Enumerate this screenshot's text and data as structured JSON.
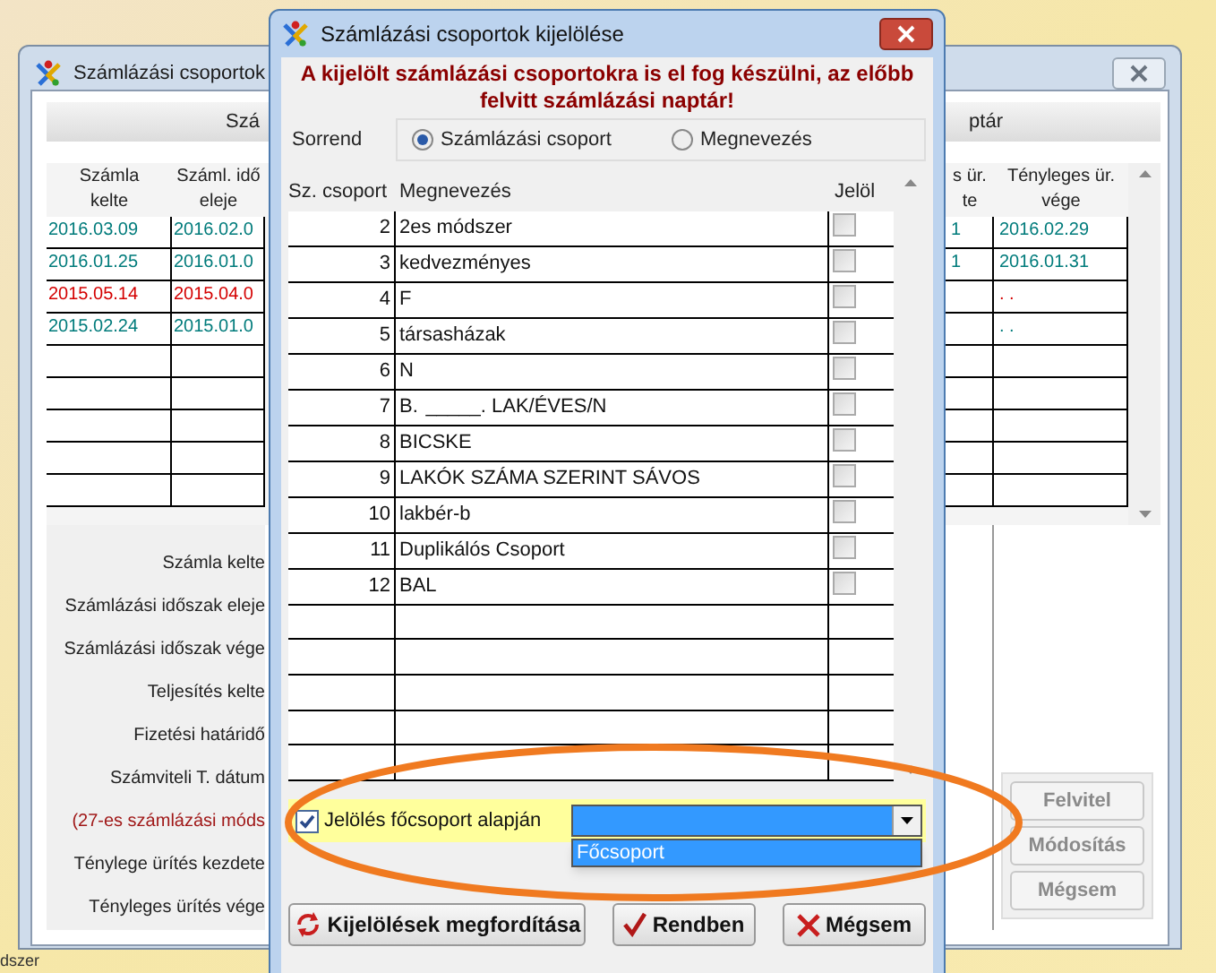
{
  "desktop": {
    "caption": "dszer"
  },
  "back_window": {
    "title": "Számlázási csoportok",
    "header_left": "Szá",
    "header_right": "ptár",
    "columns": [
      {
        "label": "Számla\nkelte"
      },
      {
        "label": "Száml. idő\neleje"
      },
      {
        "label": "s ür.\nte"
      },
      {
        "label": "Tényleges ür.\nvége"
      }
    ],
    "rows": [
      {
        "color": "#007b7b",
        "cells": [
          "2016.03.09",
          "2016.02.0",
          "1",
          "2016.02.29"
        ]
      },
      {
        "color": "#007b7b",
        "cells": [
          "2016.01.25",
          "2016.01.0",
          "1",
          "2016.01.31"
        ]
      },
      {
        "color": "#d40000",
        "cells": [
          "2015.05.14",
          "2015.04.0",
          "",
          ". ."
        ]
      },
      {
        "color": "#007b7b",
        "cells": [
          "2015.02.24",
          "2015.01.0",
          "",
          ". ."
        ]
      }
    ],
    "form_labels": [
      {
        "text": "Számla kelte",
        "kind": "normal"
      },
      {
        "text": "Számlázási időszak eleje",
        "kind": "normal"
      },
      {
        "text": "Számlázási időszak vége",
        "kind": "normal"
      },
      {
        "text": "Teljesítés kelte",
        "kind": "normal"
      },
      {
        "text": "Fizetési határidő",
        "kind": "normal"
      },
      {
        "text": "Számviteli T. dátum",
        "kind": "normal"
      },
      {
        "text": "(27-es számlázási móds",
        "kind": "note"
      },
      {
        "text": "Ténylege ürítés kezdete",
        "kind": "normal"
      },
      {
        "text": "Tényleges ürítés vége",
        "kind": "normal"
      }
    ],
    "buttons": [
      {
        "label": "Felvitel",
        "disabled": true
      },
      {
        "label": "Módosítás",
        "disabled": true
      },
      {
        "label": "Mégsem",
        "disabled": true
      }
    ]
  },
  "dialog": {
    "title": "Számlázási csoportok kijelölése",
    "warning": "A kijelölt számlázási csoportokra is el fog készülni, az előbb felvitt számlázási naptár!",
    "sort_label": "Sorrend",
    "sort_options": [
      {
        "label": "Számlázási csoport",
        "selected": true
      },
      {
        "label": "Megnevezés",
        "selected": false
      }
    ],
    "columns": [
      "Sz. csoport",
      "Megnevezés",
      "Jelöl"
    ],
    "rows": [
      {
        "number": "2",
        "name": "2es módszer",
        "checked": false
      },
      {
        "number": "3",
        "name": "kedvezményes",
        "checked": false
      },
      {
        "number": "4",
        "name": "F",
        "checked": false
      },
      {
        "number": "5",
        "name": "társasházak",
        "checked": false
      },
      {
        "number": "6",
        "name": "N",
        "checked": false
      },
      {
        "number": "7",
        "name": "B.  _____. LAK/ÉVES/N",
        "checked": false
      },
      {
        "number": "8",
        "name": "BICSKE",
        "checked": false
      },
      {
        "number": "9",
        "name": "LAKÓK SZÁMA SZERINT SÁVOS",
        "checked": false
      },
      {
        "number": "10",
        "name": "lakbér-b",
        "checked": false
      },
      {
        "number": "11",
        "name": "Duplikálós Csoport",
        "checked": false
      },
      {
        "number": "12",
        "name": "BAL",
        "checked": false
      }
    ],
    "main_group": {
      "label": "Jelölés főcsoport alapján",
      "checked": true,
      "expanded": true,
      "option": "Főcsoport"
    },
    "buttons": [
      {
        "label": "Kijelölések megfordítása",
        "kind": "invert"
      },
      {
        "label": "Rendben",
        "kind": "ok"
      },
      {
        "label": "Mégsem",
        "kind": "cancel"
      }
    ]
  }
}
